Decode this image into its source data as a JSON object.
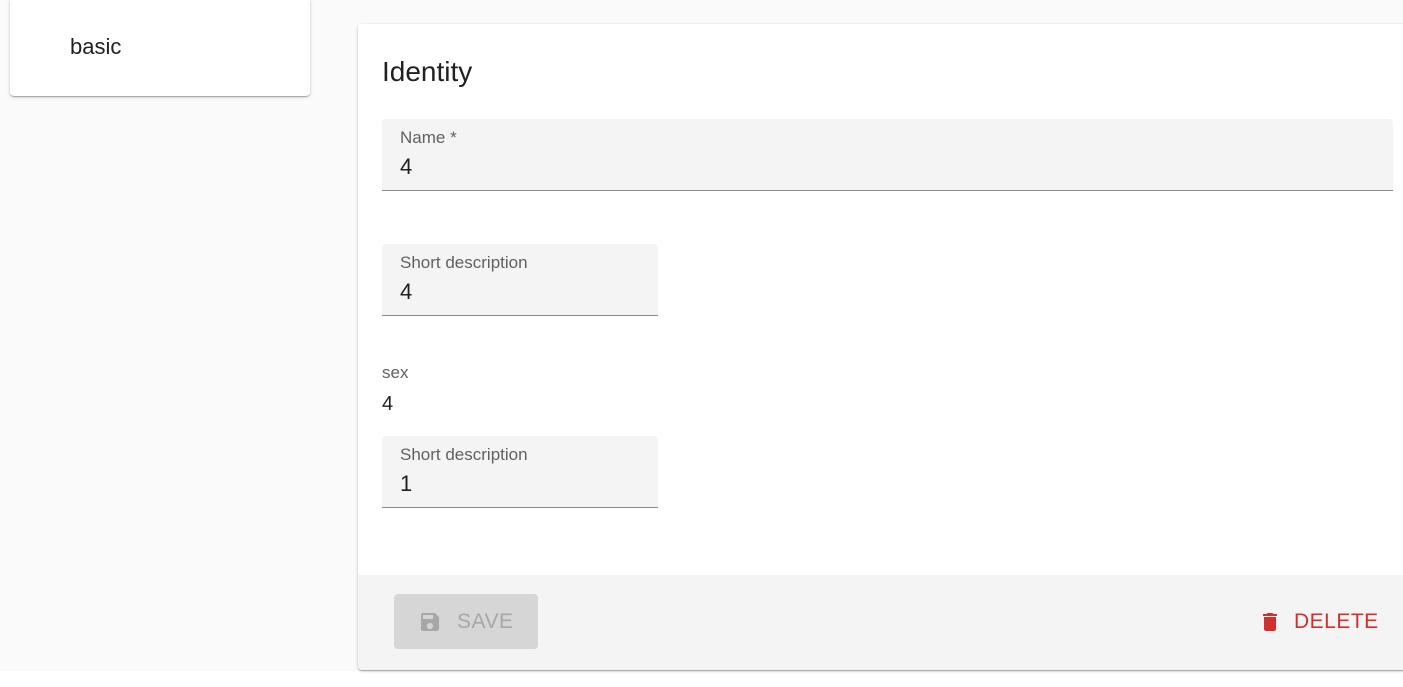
{
  "tabs": [
    {
      "label": "basic"
    }
  ],
  "form": {
    "section_title": "Identity",
    "name_field": {
      "label": "Name *",
      "value": "4"
    },
    "short_description_1": {
      "label": "Short description",
      "value": "4"
    },
    "sex": {
      "label": "sex",
      "value": "4"
    },
    "short_description_2": {
      "label": "Short description",
      "value": "1"
    }
  },
  "toolbar": {
    "save_label": "SAVE",
    "save_icon": "save-icon",
    "delete_label": "DELETE",
    "delete_icon": "delete-icon"
  },
  "colors": {
    "background": "#fafafa",
    "field_background": "#f4f4f4",
    "delete_red": "#d32f2f",
    "save_disabled_bg": "#d6d6d6",
    "save_disabled_text": "#a7a7a7"
  }
}
